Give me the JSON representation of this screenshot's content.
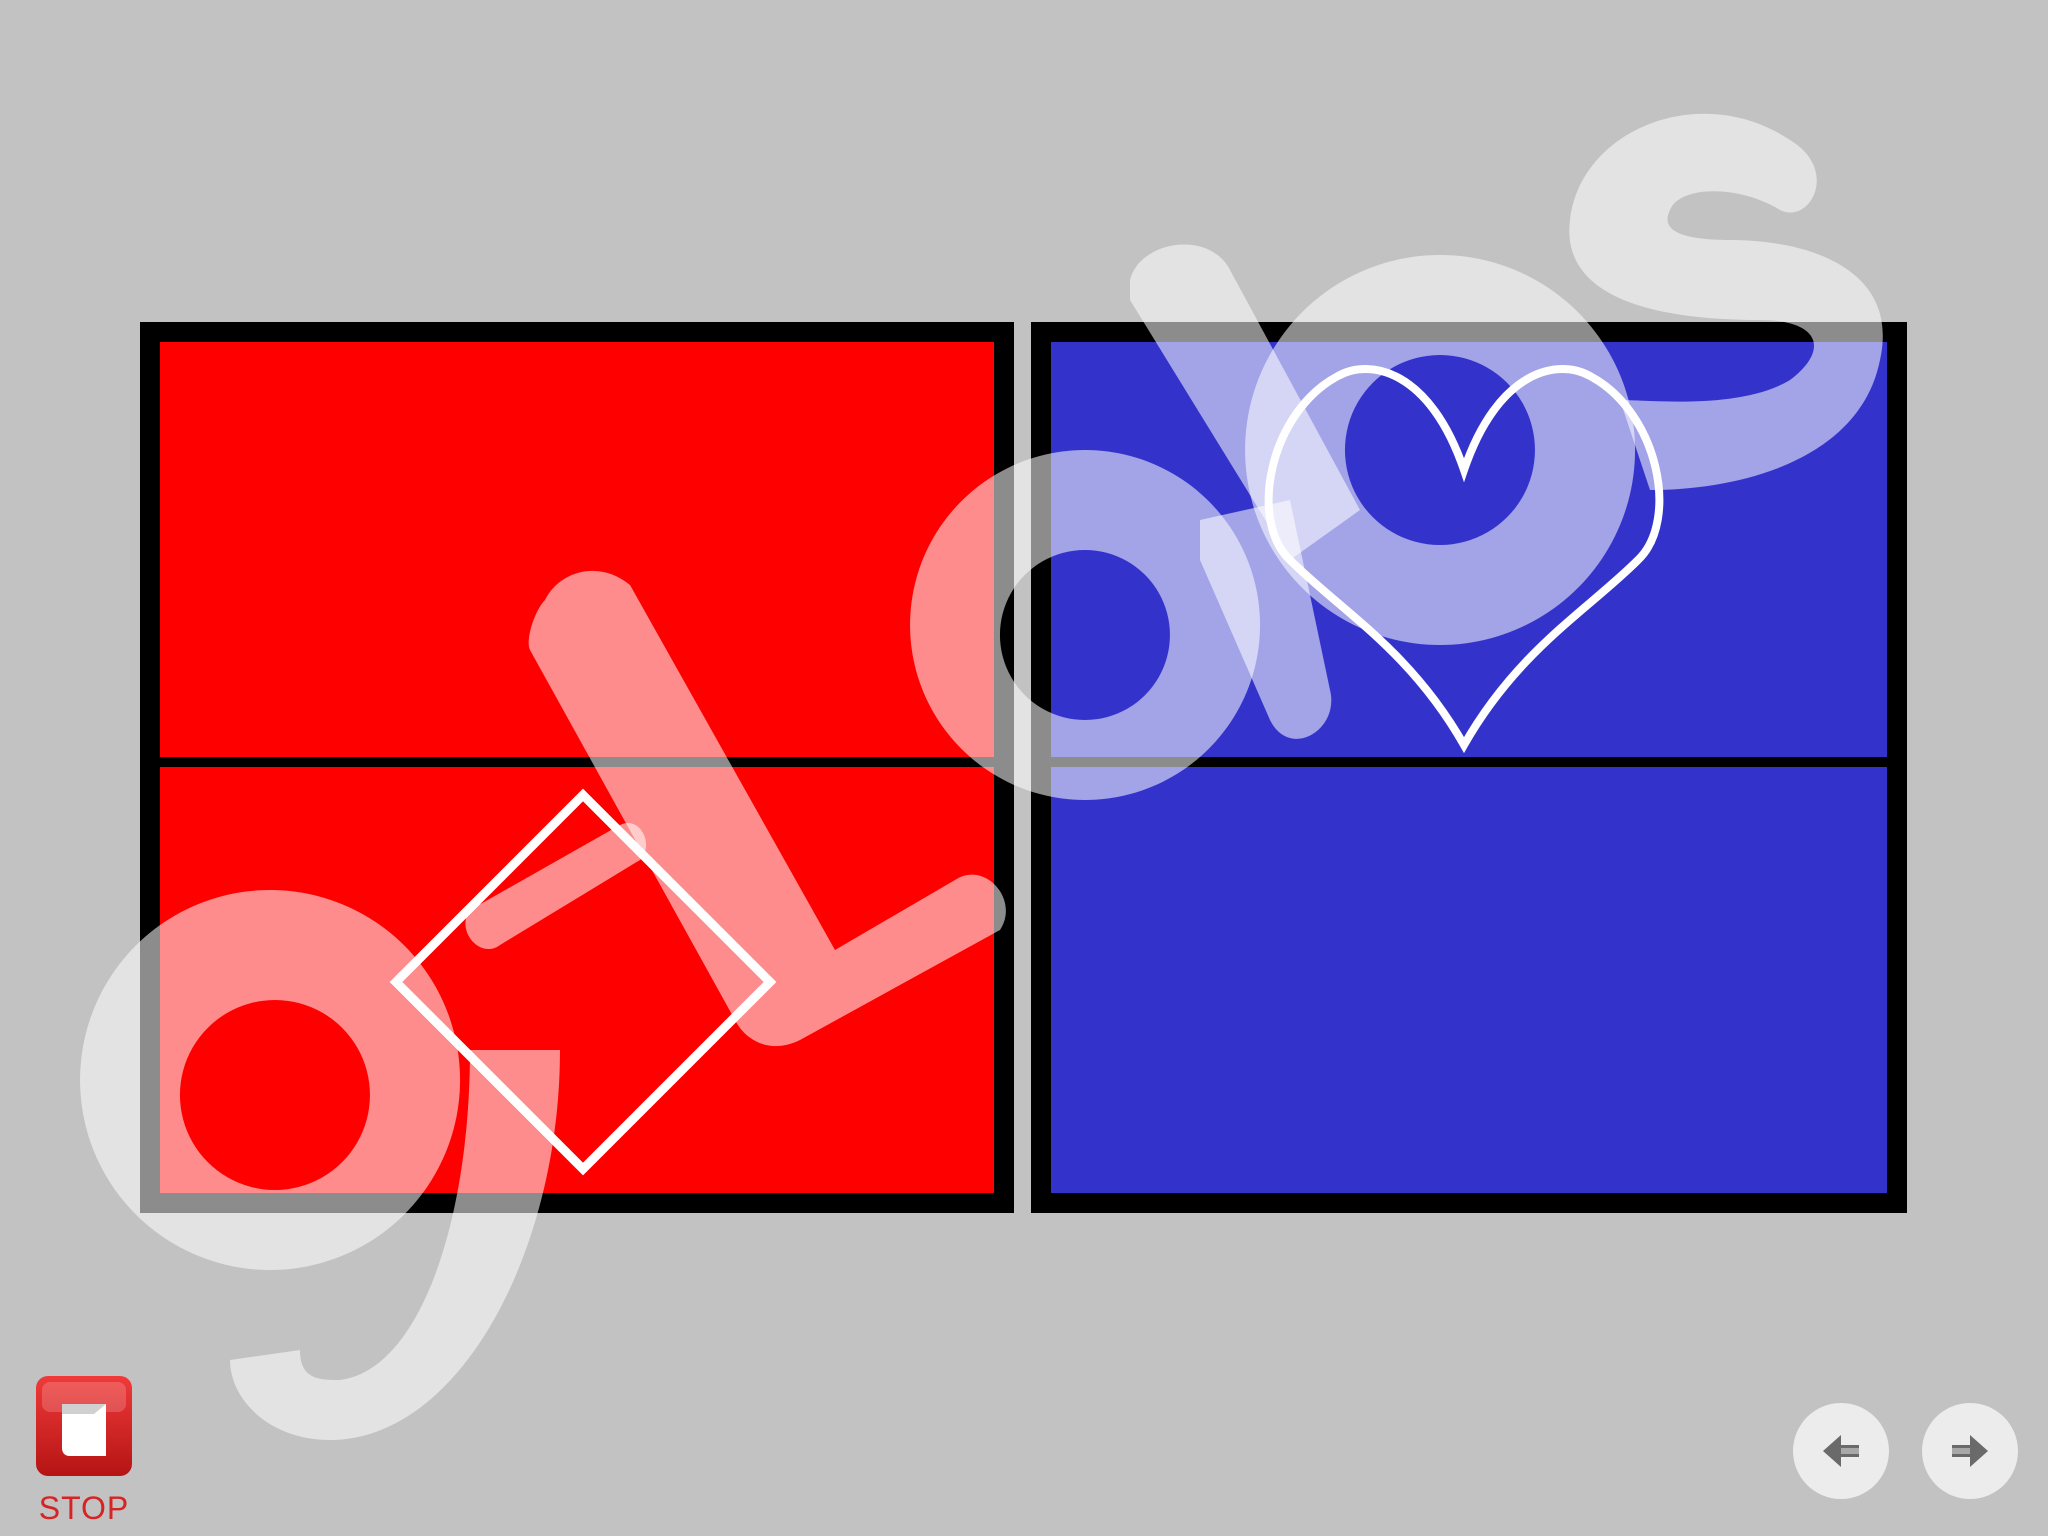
{
  "game": {
    "quadrants": [
      {
        "id": "top-left",
        "color": "#ff0000",
        "shape": "none"
      },
      {
        "id": "bottom-left",
        "color": "#ff0000",
        "shape": "diamond"
      },
      {
        "id": "top-right",
        "color": "#3333cc",
        "shape": "heart"
      },
      {
        "id": "bottom-right",
        "color": "#3333cc",
        "shape": "none"
      }
    ],
    "shape_outline_color": "#ffffff",
    "border_color": "#000000"
  },
  "watermark": {
    "text": "g-Labs",
    "color": "#ffffff"
  },
  "controls": {
    "stop_label": "STOP",
    "stop_color": "#d62424",
    "prev_icon": "arrow-left-icon",
    "next_icon": "arrow-right-icon"
  }
}
